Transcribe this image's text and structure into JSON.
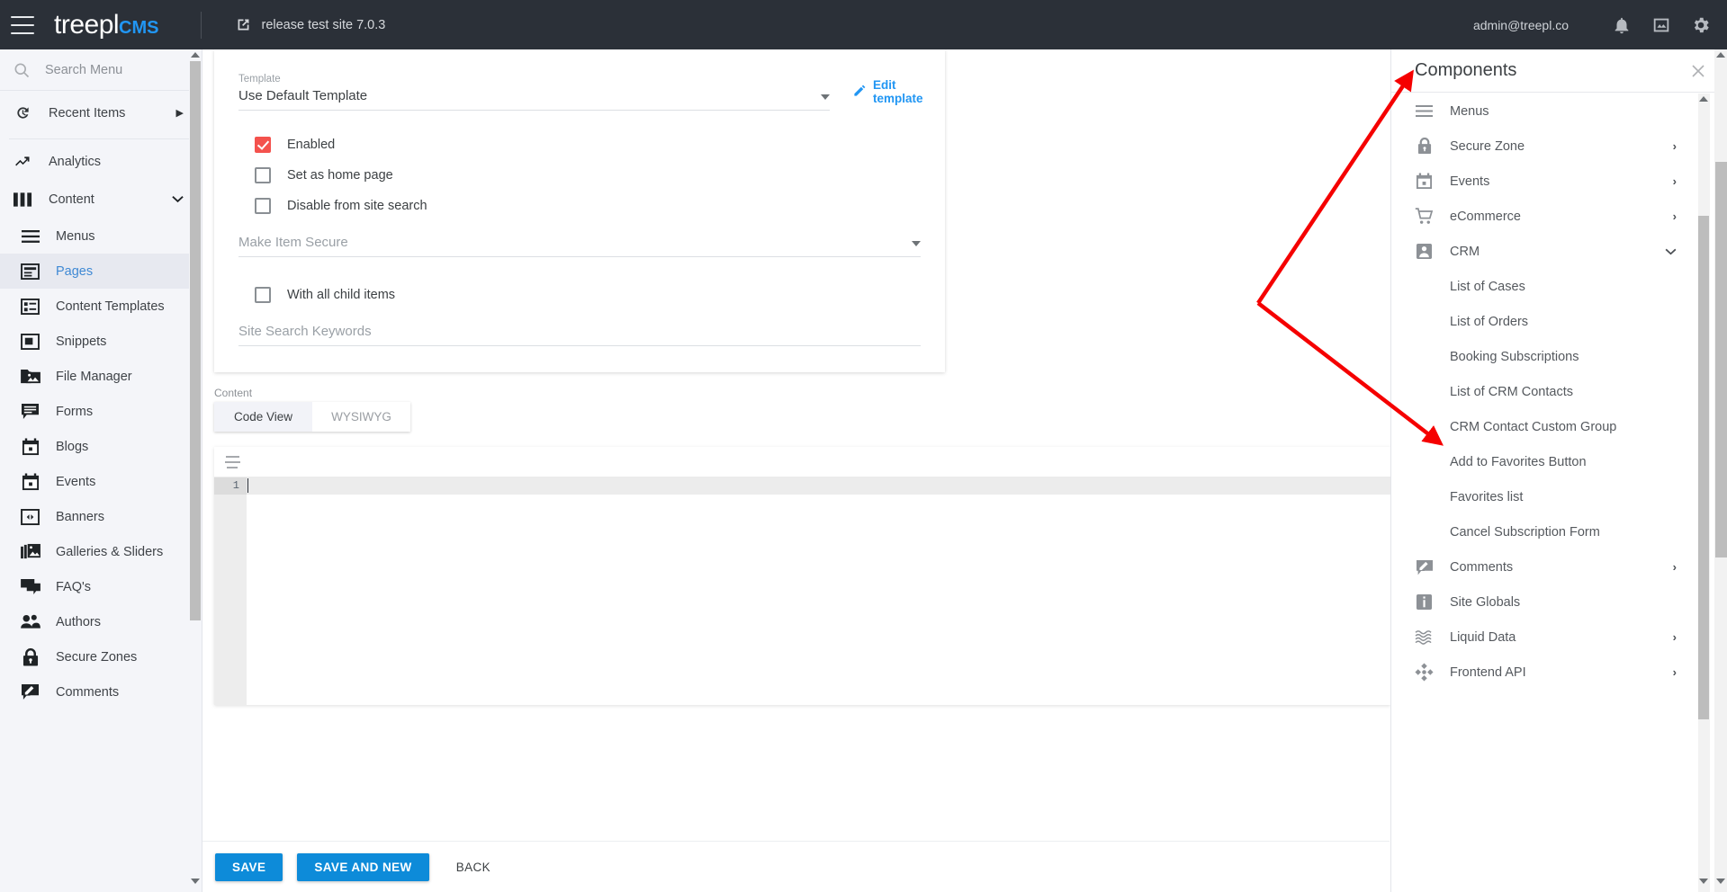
{
  "topbar": {
    "menu_icon": "hamburger-icon",
    "brand_primary": "treepl",
    "brand_secondary": "CMS",
    "site_label": "release test site 7.0.3",
    "site_icon": "external-link-icon",
    "user_email": "admin@treepl.co",
    "icons": [
      "bell-icon",
      "image-icon",
      "gear-icon"
    ]
  },
  "sidebar": {
    "search": {
      "placeholder": "Search Menu",
      "value": "",
      "icon": "search-icon"
    },
    "recent": {
      "label": "Recent Items",
      "icon": "history-icon",
      "caret": "▶"
    },
    "items": [
      {
        "label": "Analytics",
        "icon": "trending-up-icon",
        "level": 0,
        "active": false,
        "caret": ""
      },
      {
        "label": "Content",
        "icon": "columns-icon",
        "level": 0,
        "active": false,
        "caret": "⌄"
      },
      {
        "label": "Menus",
        "icon": "menu-lines-icon",
        "level": 1,
        "active": false,
        "caret": ""
      },
      {
        "label": "Pages",
        "icon": "page-icon",
        "level": 1,
        "active": true,
        "caret": ""
      },
      {
        "label": "Content Templates",
        "icon": "template-icon",
        "level": 1,
        "active": false,
        "caret": ""
      },
      {
        "label": "Snippets",
        "icon": "snippet-icon",
        "level": 1,
        "active": false,
        "caret": ""
      },
      {
        "label": "File Manager",
        "icon": "folder-image-icon",
        "level": 1,
        "active": false,
        "caret": ""
      },
      {
        "label": "Forms",
        "icon": "form-icon",
        "level": 1,
        "active": false,
        "caret": ""
      },
      {
        "label": "Blogs",
        "icon": "calendar-icon",
        "level": 1,
        "active": false,
        "caret": ""
      },
      {
        "label": "Events",
        "icon": "calendar-icon",
        "level": 1,
        "active": false,
        "caret": ""
      },
      {
        "label": "Banners",
        "icon": "banner-icon",
        "level": 1,
        "active": false,
        "caret": ""
      },
      {
        "label": "Galleries & Sliders",
        "icon": "gallery-icon",
        "level": 1,
        "active": false,
        "caret": ""
      },
      {
        "label": "FAQ's",
        "icon": "chat-icon",
        "level": 1,
        "active": false,
        "caret": ""
      },
      {
        "label": "Authors",
        "icon": "people-icon",
        "level": 1,
        "active": false,
        "caret": ""
      },
      {
        "label": "Secure Zones",
        "icon": "lock-icon",
        "level": 1,
        "active": false,
        "caret": ""
      },
      {
        "label": "Comments",
        "icon": "comment-edit-icon",
        "level": 1,
        "active": false,
        "caret": ""
      }
    ]
  },
  "form": {
    "template": {
      "label": "Template",
      "value": "Use Default Template"
    },
    "edit_template_link": "Edit template",
    "checkboxes": [
      {
        "label": "Enabled",
        "checked": true
      },
      {
        "label": "Set as home page",
        "checked": false
      },
      {
        "label": "Disable from site search",
        "checked": false
      }
    ],
    "make_item_secure": {
      "placeholder": "Make Item Secure",
      "value": ""
    },
    "with_all_child_items": {
      "label": "With all child items",
      "checked": false
    },
    "site_search_keywords": {
      "placeholder": "Site Search Keywords",
      "value": ""
    }
  },
  "content": {
    "label": "Content",
    "tabs": [
      {
        "label": "Code View",
        "selected": true
      },
      {
        "label": "WYSIWYG",
        "selected": false
      }
    ],
    "editor": {
      "line_numbers": [
        "1"
      ],
      "lines": [
        ""
      ],
      "toolbar_icon": "align-lines-icon"
    }
  },
  "actions": {
    "save": "SAVE",
    "save_and_new": "SAVE AND NEW",
    "back": "BACK"
  },
  "panel": {
    "title": "Components",
    "close_icon": "close-icon",
    "items": [
      {
        "label": "Menus",
        "icon": "menu-lines-icon",
        "sub": false,
        "chevron": ""
      },
      {
        "label": "Secure Zone",
        "icon": "lock-icon",
        "sub": false,
        "chevron": "›"
      },
      {
        "label": "Events",
        "icon": "calendar-icon",
        "sub": false,
        "chevron": "›"
      },
      {
        "label": "eCommerce",
        "icon": "cart-icon",
        "sub": false,
        "chevron": "›"
      },
      {
        "label": "CRM",
        "icon": "person-badge-icon",
        "sub": false,
        "chevron": "⌄"
      },
      {
        "label": "List of Cases",
        "icon": "",
        "sub": true,
        "chevron": ""
      },
      {
        "label": "List of Orders",
        "icon": "",
        "sub": true,
        "chevron": ""
      },
      {
        "label": "Booking Subscriptions",
        "icon": "",
        "sub": true,
        "chevron": ""
      },
      {
        "label": "List of CRM Contacts",
        "icon": "",
        "sub": true,
        "chevron": ""
      },
      {
        "label": "CRM Contact Custom Group",
        "icon": "",
        "sub": true,
        "chevron": ""
      },
      {
        "label": "Add to Favorites Button",
        "icon": "",
        "sub": true,
        "chevron": ""
      },
      {
        "label": "Favorites list",
        "icon": "",
        "sub": true,
        "chevron": ""
      },
      {
        "label": "Cancel Subscription Form",
        "icon": "",
        "sub": true,
        "chevron": ""
      },
      {
        "label": "Comments",
        "icon": "comment-edit-icon",
        "sub": false,
        "chevron": "›"
      },
      {
        "label": "Site Globals",
        "icon": "info-icon",
        "sub": false,
        "chevron": ""
      },
      {
        "label": "Liquid Data",
        "icon": "waves-icon",
        "sub": false,
        "chevron": "›"
      },
      {
        "label": "Frontend API",
        "icon": "api-nodes-icon",
        "sub": false,
        "chevron": "›"
      }
    ]
  },
  "annotation": {
    "color": "#f50000",
    "shape": "double-arrow-v",
    "targets": [
      "Components",
      "Booking Subscriptions"
    ]
  }
}
